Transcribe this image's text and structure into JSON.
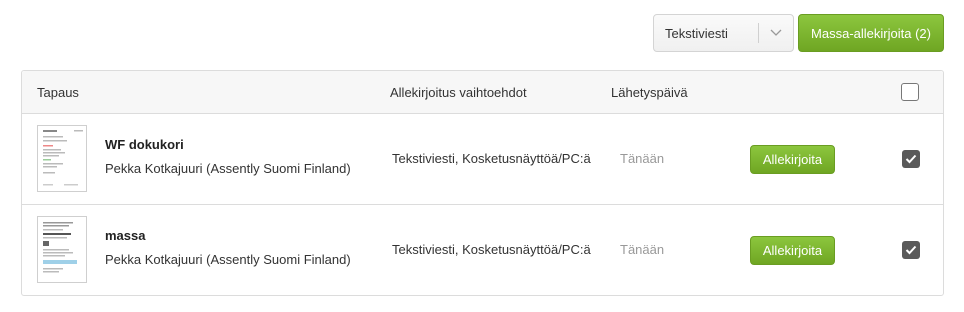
{
  "toolbar": {
    "method_select_value": "Tekstiviesti",
    "mass_sign_label": "Massa-allekirjoita (2)"
  },
  "table": {
    "headers": {
      "case": "Tapaus",
      "options": "Allekirjoitus vaihtoehdot",
      "date": "Lähetyspäivä"
    },
    "select_all_checked": false,
    "rows": [
      {
        "title": "WF dokukori",
        "sender": "Pekka Kotkajuuri (Assently Suomi Finland)",
        "options": "Tekstiviesti, Kosketusnäyttöä/PC:ä",
        "date": "Tänään",
        "sign_label": "Allekirjoita",
        "checked": true,
        "thumbnail_icon": "document-thumbnail"
      },
      {
        "title": "massa",
        "sender": "Pekka Kotkajuuri (Assently Suomi Finland)",
        "options": "Tekstiviesti, Kosketusnäyttöä/PC:ä",
        "date": "Tänään",
        "sign_label": "Allekirjoita",
        "checked": true,
        "thumbnail_icon": "document-thumbnail"
      }
    ]
  },
  "colors": {
    "accent_green": "#7db731",
    "checkbox_dark": "#5a5a5a",
    "muted_text": "#999999"
  }
}
